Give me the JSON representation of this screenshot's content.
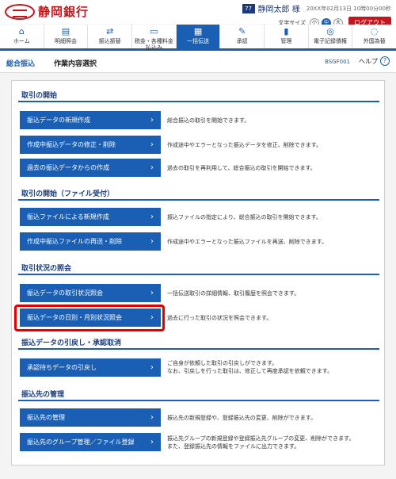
{
  "header": {
    "bank_name": "静岡銀行",
    "user_name": "静岡太郎 様",
    "user_badge": "77",
    "login_time": "20XX年02月13日 10時00分00秒",
    "font_size_label": "文字サイズ",
    "font_sizes": [
      "小",
      "中",
      "大"
    ],
    "logout": "ログアウト"
  },
  "nav": [
    {
      "label": "ホーム",
      "icon": "home-icon",
      "glyph": "⌂"
    },
    {
      "label": "明細照会",
      "icon": "statement-icon",
      "glyph": "▤"
    },
    {
      "label": "振込振替",
      "icon": "transfer-icon",
      "glyph": "⇄"
    },
    {
      "label": "税金・各種料金払込み",
      "icon": "tax-icon",
      "glyph": "▭"
    },
    {
      "label": "一括伝送",
      "icon": "batch-icon",
      "glyph": "▦"
    },
    {
      "label": "承認",
      "icon": "approve-icon",
      "glyph": "✎"
    },
    {
      "label": "管理",
      "icon": "admin-icon",
      "glyph": "▮"
    },
    {
      "label": "電子記録債権",
      "icon": "erecord-icon",
      "glyph": "◎"
    },
    {
      "label": "外国為替",
      "icon": "forex-icon",
      "glyph": "◌"
    }
  ],
  "subheader": {
    "section": "総合振込",
    "page": "作業内容選択",
    "screen_id": "BSGF001",
    "help": "ヘルプ"
  },
  "sections": [
    {
      "title": "取引の開始",
      "rows": [
        {
          "button": "振込データの新規作成",
          "desc": [
            "総合振込の取引を開始できます。"
          ]
        },
        {
          "button": "作成中振込データの修正・削除",
          "desc": [
            "作成途中やエラーとなった振込データを修正、削除できます。"
          ]
        },
        {
          "button": "過去の振込データからの作成",
          "desc": [
            "過去の取引を再利用して、総合振込の取引を開始できます。"
          ]
        }
      ]
    },
    {
      "title": "取引の開始（ファイル受付）",
      "rows": [
        {
          "button": "振込ファイルによる新規作成",
          "desc": [
            "振込ファイルの指定により、総合振込の取引を開始できます。"
          ]
        },
        {
          "button": "作成中振込ファイルの再送・削除",
          "desc": [
            "作成途中やエラーとなった振込ファイルを再送、削除できます。"
          ]
        }
      ]
    },
    {
      "title": "取引状況の照会",
      "rows": [
        {
          "button": "振込データの取引状況照会",
          "desc": [
            "一括伝送取引の詳細情報、取引履歴を照会できます。"
          ]
        },
        {
          "button": "振込データの日別・月別状況照会",
          "desc": [
            "過去に行った取引の状況を照会できます。"
          ],
          "highlighted": true
        }
      ]
    },
    {
      "title": "振込データの引戻し・承認取消",
      "rows": [
        {
          "button": "承認待ちデータの引戻し",
          "desc": [
            "ご自身が依頼した取引の引戻しができます。",
            "なお、引戻しを行った取引は、修正して再度承認を依頼できます。"
          ]
        }
      ]
    },
    {
      "title": "振込先の管理",
      "rows": [
        {
          "button": "振込先の管理",
          "desc": [
            "振込先の新規登録や、登録振込先の変更、削除ができます。"
          ]
        },
        {
          "button": "振込先のグループ管理／ファイル登録",
          "desc": [
            "振込先グループの新規登録や登録振込先グループの変更、削除ができます。",
            "また、登録振込先の情報をファイルに出力できます。"
          ]
        }
      ]
    }
  ],
  "colors": {
    "brand": "#c4161c",
    "primary": "#1a5fb4",
    "highlight": "#e00000"
  }
}
